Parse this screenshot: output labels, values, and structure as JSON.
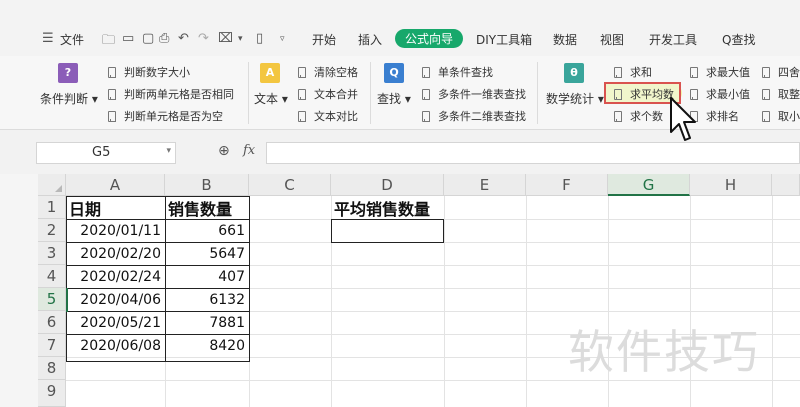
{
  "menubar": {
    "file_label": "文件",
    "tabs": [
      {
        "label": "开始",
        "active": false
      },
      {
        "label": "插入",
        "active": false
      },
      {
        "label": "公式向导",
        "active": true
      },
      {
        "label": "DIY工具箱",
        "active": false
      },
      {
        "label": "数据",
        "active": false
      },
      {
        "label": "视图",
        "active": false
      },
      {
        "label": "开发工具",
        "active": false
      }
    ],
    "search_label": "Q查找"
  },
  "ribbon": {
    "condition_label": "条件判断",
    "condition_items": [
      "判断数字大小",
      "判断两单元格是否相同",
      "判断单元格是否为空"
    ],
    "text_label": "文本",
    "text_items": [
      "清除空格",
      "文本合并",
      "文本对比"
    ],
    "lookup_label": "查找",
    "lookup_items": [
      "单条件查找",
      "多条件一维表查找",
      "多条件二维表查找"
    ],
    "stats_label": "数学统计",
    "stats_col1": [
      "求和",
      "求平均数",
      "求个数"
    ],
    "stats_col2": [
      "求最大值",
      "求最小值",
      "求排名"
    ],
    "stats_col3": [
      "四舍五",
      "取整",
      "取小"
    ]
  },
  "formula": {
    "cell_ref": "G5",
    "fx": "fx",
    "value": ""
  },
  "sheet": {
    "columns": [
      "A",
      "B",
      "C",
      "D",
      "E",
      "F",
      "G",
      "H"
    ],
    "rows": [
      "1",
      "2",
      "3",
      "4",
      "5",
      "6",
      "7",
      "8",
      "9"
    ],
    "header_date": "日期",
    "header_qty": "销售数量",
    "header_avg": "平均销售数量",
    "data": [
      {
        "date": "2020/01/11",
        "qty": "661"
      },
      {
        "date": "2020/02/20",
        "qty": "5647"
      },
      {
        "date": "2020/02/24",
        "qty": "407"
      },
      {
        "date": "2020/04/06",
        "qty": "6132"
      },
      {
        "date": "2020/05/21",
        "qty": "7881"
      },
      {
        "date": "2020/06/08",
        "qty": "8420"
      }
    ]
  },
  "watermark": "软件技巧",
  "colors": {
    "accent": "#17a86b",
    "highlight_border": "#d9534f",
    "selected": "#217346"
  }
}
